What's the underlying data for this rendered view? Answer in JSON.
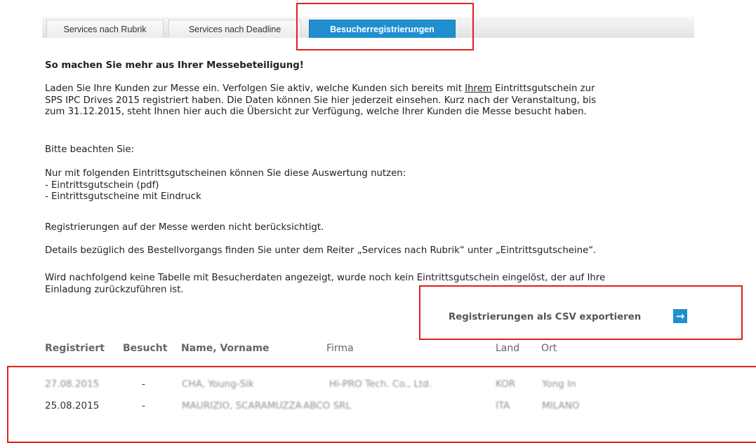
{
  "tabs": [
    {
      "label": "Services nach Rubrik"
    },
    {
      "label": "Services nach Deadline"
    },
    {
      "label": "Besucherregistrierungen"
    }
  ],
  "headline": "So machen Sie mehr aus Ihrer Messebeteiligung!",
  "intro": {
    "line1_before": "Laden Sie Ihre Kunden zur Messe ein. Verfolgen Sie aktiv, welche Kunden sich bereits mit ",
    "line1_underlined": "Ihrem",
    "line1_after": " Eintrittsgutschein zur",
    "line2": "SPS IPC Drives 2015 registriert haben. Die Daten können Sie hier jederzeit einsehen. Kurz nach der Veranstaltung, bis",
    "line3": "zum 31.12.2015, steht Ihnen hier auch die Übersicht zur Verfügung, welche Ihrer Kunden die Messe besucht haben."
  },
  "note_heading": "Bitte beachten Sie:",
  "vouchers": {
    "intro": "Nur mit folgenden Eintrittsgutscheinen können Sie diese Auswertung nutzen:",
    "item1": "- Eintrittsgutschein (pdf)",
    "item2": "- Eintrittsgutscheine mit Eindruck"
  },
  "not_considered": "Registrierungen auf der Messe werden nicht berücksichtigt.",
  "details": "Details bezüglich des Bestellvorgangs finden Sie unter dem Reiter „Services nach Rubrik“ unter „Eintrittsgutscheine“.",
  "no_table": {
    "line1": "Wird nachfolgend keine Tabelle mit Besucherdaten angezeigt, wurde noch kein Eintrittsgutschein eingelöst, der auf Ihre",
    "line2": "Einladung zurückzuführen ist."
  },
  "export": {
    "label": "Registrierungen als CSV exportieren",
    "icon": "arrow-right-icon",
    "glyph": "→"
  },
  "table": {
    "headers": [
      "Registriert",
      "Besucht",
      "Name, Vorname",
      "Firma",
      "Land",
      "Ort"
    ],
    "rows": [
      [
        "27.08.2015",
        "-",
        "CHA, Young-Sik",
        "Hi-PRO Tech. Co., Ltd.",
        "KOR",
        "Yong In"
      ],
      [
        "25.08.2015",
        "-",
        "MAURIZIO, SCARAMUZZA",
        "ABCO SRL",
        "ITA",
        "MILANO"
      ]
    ]
  },
  "colors": {
    "accent": "#1f8fd0",
    "highlight": "#e0201a"
  }
}
